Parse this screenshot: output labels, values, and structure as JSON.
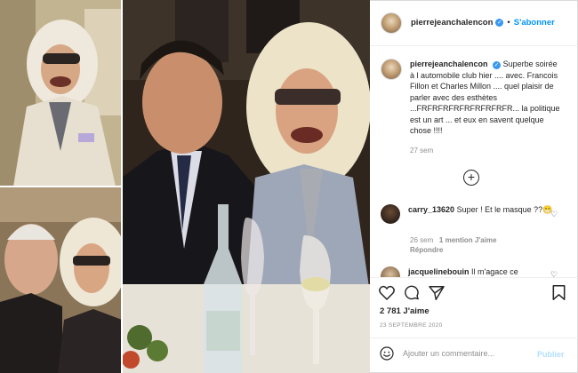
{
  "post": {
    "username": "pierrejeanchalencon",
    "dot": "•",
    "follow_label": "S'abonner",
    "caption_text": "Superbe soirée à l automobile club hier .... avec. Francois Fillon et Charles Millon .... quel plaisir de parler avec des esthètes ...FRFRFRFRFRFRFRFRFR... la politique est un art ... et eux en savent quelque chose !!!!",
    "caption_time": "27 sem",
    "more_icon": "+"
  },
  "comments": [
    {
      "username": "carry_13620",
      "text": "Super ! Et le masque ??",
      "emoji": "😁",
      "time": "26 sem",
      "likes": "1 mention J'aime",
      "reply": "Répondre"
    },
    {
      "username": "jacquelinebouin",
      "text": "Il m'agace ce"
    }
  ],
  "actions": {
    "likes": "2 781 J'aime",
    "date": "23 SEPTEMBRE 2020",
    "icons": [
      "heart-icon",
      "comment-icon",
      "share-icon",
      "bookmark-icon"
    ]
  },
  "composer": {
    "placeholder": "Ajouter un commentaire...",
    "publish_label": "Publier",
    "emoji_icon": "smiley-icon"
  },
  "colors": {
    "accent": "#0095f6",
    "verified": "#3897f0",
    "muted": "#8e8e8e",
    "publish_disabled": "#b2dffc"
  }
}
